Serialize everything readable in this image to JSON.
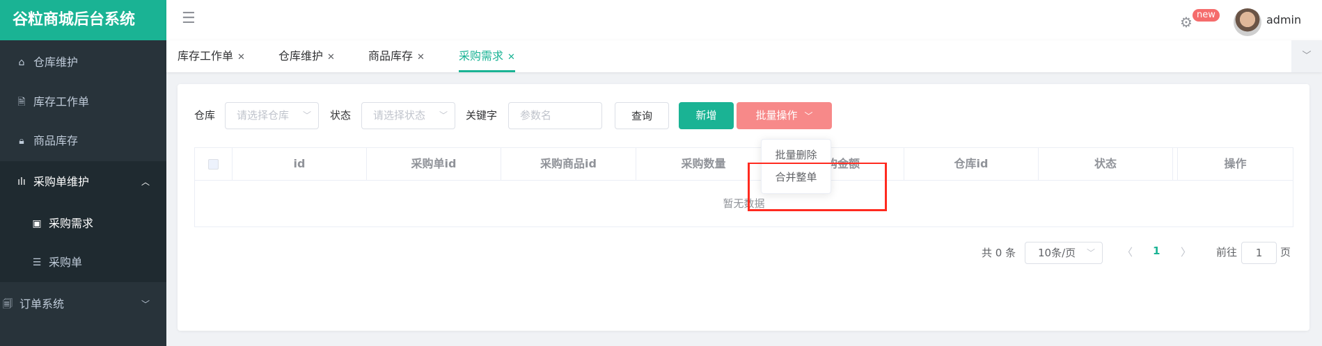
{
  "app": {
    "title": "谷粒商城后台系统"
  },
  "sidebar": {
    "items": [
      {
        "label": "仓库维护",
        "icon": "home-icon"
      },
      {
        "label": "库存工作单",
        "icon": "document-icon"
      },
      {
        "label": "商品库存",
        "icon": "lock-icon"
      },
      {
        "label": "采购单维护",
        "icon": "chart-icon"
      },
      {
        "label": "采购需求",
        "icon": "window-icon"
      },
      {
        "label": "采购单",
        "icon": "list-icon"
      },
      {
        "label": "订单系统",
        "icon": "order-icon"
      }
    ]
  },
  "header": {
    "badge": "new",
    "user": "admin"
  },
  "tabs": [
    {
      "label": "库存工作单"
    },
    {
      "label": "仓库维护"
    },
    {
      "label": "商品库存"
    },
    {
      "label": "采购需求"
    }
  ],
  "filters": {
    "warehouse_label": "仓库",
    "warehouse_placeholder": "请选择仓库",
    "status_label": "状态",
    "status_placeholder": "请选择状态",
    "keyword_label": "关键字",
    "keyword_placeholder": "参数名",
    "query": "查询",
    "add": "新增",
    "batch": "批量操作"
  },
  "dropdown": {
    "items": [
      "批量删除",
      "合并整单"
    ]
  },
  "table": {
    "columns": [
      "id",
      "采购单id",
      "采购商品id",
      "采购数量",
      "采购金额",
      "仓库id",
      "状态",
      "操作"
    ],
    "empty": "暂无数据"
  },
  "pagination": {
    "total": "共 0 条",
    "page_size": "10条/页",
    "current": "1",
    "goto_label": "前往",
    "goto_value": "1",
    "page_suffix": "页"
  },
  "colors": {
    "brand": "#1ab394",
    "danger_light": "#f78989",
    "highlight": "#ff2a1f"
  }
}
